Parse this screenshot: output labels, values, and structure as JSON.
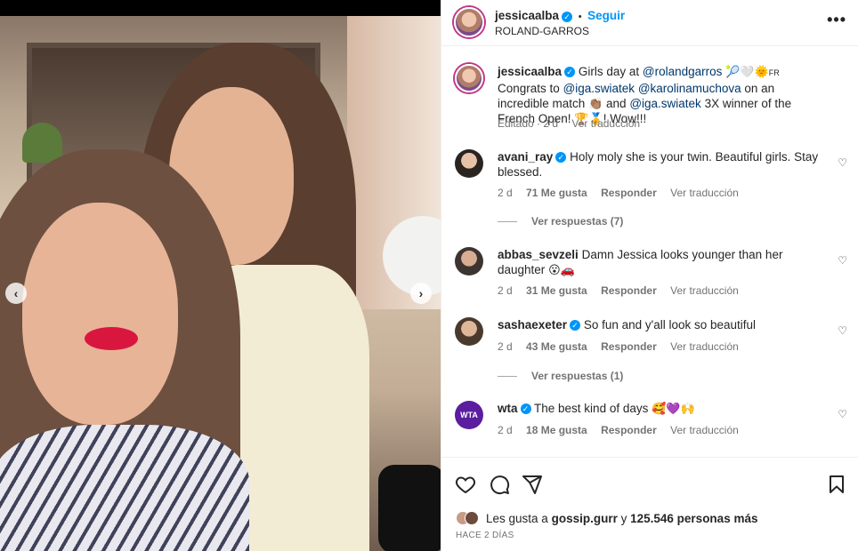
{
  "post": {
    "username": "jessicaalba",
    "separator": "•",
    "follow_label": "Seguir",
    "location": "ROLAND-GARROS",
    "more_label": "•••"
  },
  "caption": {
    "username": "jessicaalba",
    "text_1": "Girls day at",
    "mention_1": "@rolandgarros",
    "emojis_1": "🎾🤍🌞",
    "flag": "FR",
    "text_2": "Congrats to",
    "mention_2": "@iga.swiatek",
    "mention_3": "@karolinamuchova",
    "text_3": "on an incredible match",
    "emojis_2": "👏🏽",
    "text_4": "and",
    "mention_4": "@iga.swiatek",
    "text_5": "3X winner of the French Open!",
    "emojis_3": "🏆🥇",
    "text_6": "! Wow!!!",
    "edited": "Editado · 2 d",
    "translate": "Ver traducción"
  },
  "comments": [
    {
      "username": "avani_ray",
      "verified": true,
      "text": "Holy moly she is your twin. Beautiful girls. Stay blessed.",
      "time": "2 d",
      "likes": "71 Me gusta",
      "reply": "Responder",
      "translate": "Ver traducción",
      "view_replies": "Ver respuestas (7)"
    },
    {
      "username": "abbas_sevzeli",
      "verified": false,
      "text": "Damn Jessica looks younger than her daughter",
      "emojis": "😮🚗",
      "time": "2 d",
      "likes": "31 Me gusta",
      "reply": "Responder",
      "translate": "Ver traducción"
    },
    {
      "username": "sashaexeter",
      "verified": true,
      "text": "So fun and y'all look so beautiful",
      "time": "2 d",
      "likes": "43 Me gusta",
      "reply": "Responder",
      "translate": "Ver traducción",
      "view_replies": "Ver respuestas (1)"
    },
    {
      "username": "wta",
      "verified": true,
      "text": "The best kind of days",
      "emojis": "🥰💜🙌",
      "time": "2 d",
      "likes": "18 Me gusta",
      "reply": "Responder",
      "translate": "Ver traducción",
      "avatar_text": "WTA"
    }
  ],
  "footer": {
    "likes_prefix": "Les gusta a",
    "likes_user": "gossip.gurr",
    "likes_mid": "y",
    "likes_count": "125.546 personas más",
    "time_ago": "HACE 2 DÍAS"
  },
  "icons": {
    "heart": "heart-icon",
    "comment": "comment-icon",
    "share": "share-icon",
    "save": "bookmark-icon",
    "prev": "chevron-left-icon",
    "next": "chevron-right-icon"
  },
  "colors": {
    "link": "#00376b",
    "accent": "#0095f6",
    "muted": "#737373",
    "wta_purple": "#5a1e9e"
  }
}
